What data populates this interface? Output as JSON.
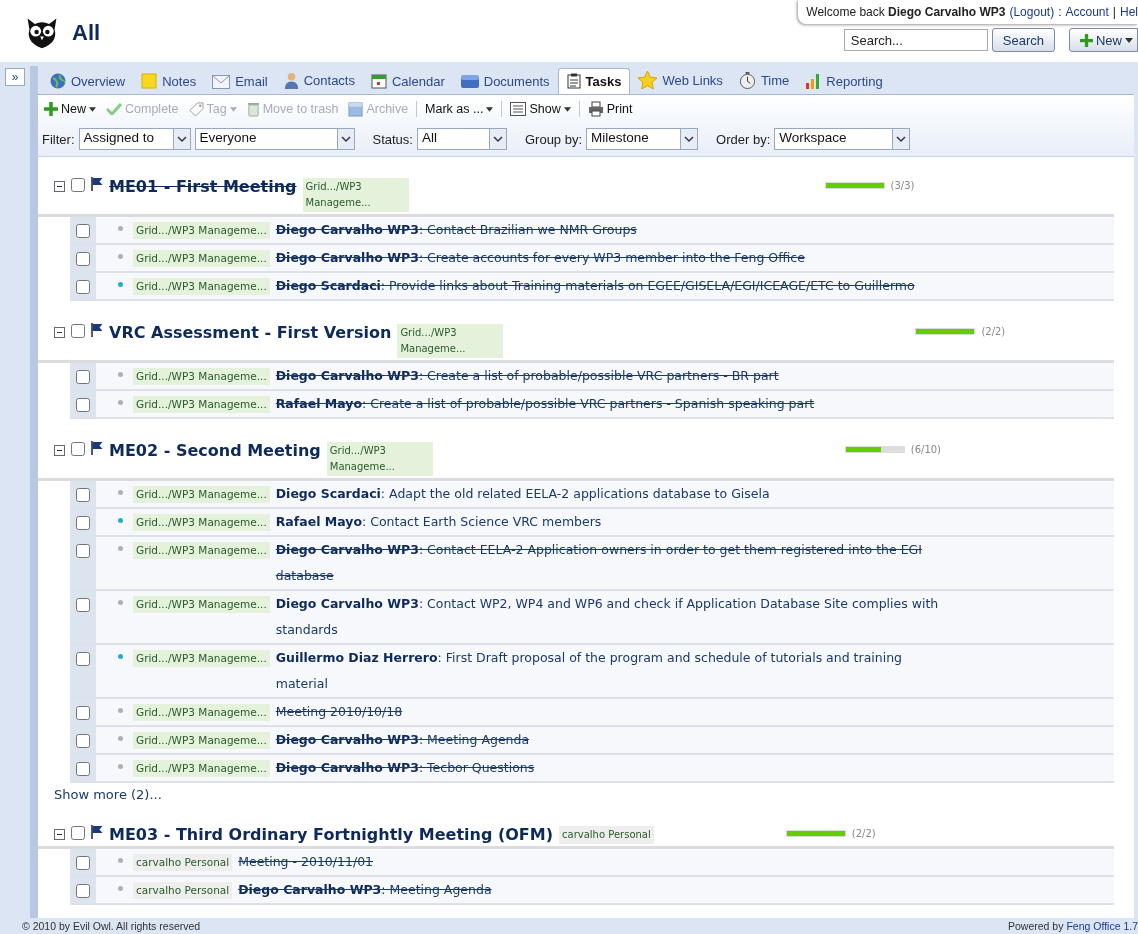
{
  "header": {
    "title": "All",
    "welcome": "Welcome back **Diego Carvalho WP3**",
    "logout": "(Logout)",
    "sep1": ":",
    "account": "Account",
    "sep2": "|",
    "help": "Hel",
    "search_placeholder": "Search...",
    "search_button": "Search",
    "new_button": "New"
  },
  "sidebar": {
    "toggle": "»"
  },
  "tabs": [
    {
      "label": "Overview",
      "selected": false
    },
    {
      "label": "Notes",
      "selected": false
    },
    {
      "label": "Email",
      "selected": false
    },
    {
      "label": "Contacts",
      "selected": false
    },
    {
      "label": "Calendar",
      "selected": false
    },
    {
      "label": "Documents",
      "selected": false
    },
    {
      "label": "Tasks",
      "selected": true
    },
    {
      "label": "Web Links",
      "selected": false
    },
    {
      "label": "Time",
      "selected": false
    },
    {
      "label": "Reporting",
      "selected": false
    }
  ],
  "toolbar": [
    {
      "label": "New",
      "dropdown": true,
      "disabled": false
    },
    {
      "label": "Complete",
      "dropdown": false,
      "disabled": true
    },
    {
      "label": "Tag",
      "dropdown": true,
      "disabled": true
    },
    {
      "label": "Move to trash",
      "dropdown": false,
      "disabled": true
    },
    {
      "label": "Archive",
      "dropdown": false,
      "disabled": true
    },
    {
      "label": "Mark as ...",
      "dropdown": true,
      "disabled": false
    },
    {
      "label": "Show",
      "dropdown": true,
      "disabled": false
    },
    {
      "label": "Print",
      "dropdown": false,
      "disabled": false
    }
  ],
  "filters": [
    {
      "label": "Filter:",
      "selects": [
        "Assigned to",
        "Everyone"
      ]
    },
    {
      "label": "Status:",
      "selects": [
        "All"
      ]
    },
    {
      "label": "Group by:",
      "selects": [
        "Milestone"
      ]
    },
    {
      "label": "Order by:",
      "selects": [
        "Workspace"
      ]
    }
  ],
  "milestones": [
    {
      "title": "ME01 - First Meeting",
      "done": true,
      "checked": false,
      "tag": {
        "label": "Grid.../WP3 Manageme...",
        "color": "#e4f2dc"
      },
      "level": 1,
      "reading": "(3/3)",
      "tasks": [
        {
          "workspace": {
            "label": "Grid.../WP3 Manageme...",
            "color": "#e4f2dc"
          },
          "checked": false,
          "high_priority": false,
          "done": true,
          "text": "**Diego Carvalho WP3**: Contact Brazilian we NMR Groups"
        },
        {
          "workspace": {
            "label": "Grid.../WP3 Manageme...",
            "color": "#e4f2dc"
          },
          "checked": false,
          "high_priority": false,
          "done": true,
          "text": "**Diego Carvalho WP3**: Create accounts for every WP3 member into the Feng Office"
        },
        {
          "workspace": {
            "label": "Grid.../WP3 Manageme...",
            "color": "#e4f2dc"
          },
          "checked": false,
          "high_priority": true,
          "done": true,
          "text": "**Diego Scardaci**: Provide links about Training materials on EGEE/GISELA/EGI/ICEAGE/ETC to Guillermo"
        }
      ]
    },
    {
      "title": "VRC Assessment - First Version",
      "done": false,
      "checked": false,
      "tag": {
        "label": "Grid.../WP3 Manageme...",
        "color": "#e4f2dc"
      },
      "level": 1,
      "reading": "(2/2)",
      "tasks": [
        {
          "workspace": {
            "label": "Grid.../WP3 Manageme...",
            "color": "#e4f2dc"
          },
          "checked": false,
          "high_priority": false,
          "done": true,
          "text": "**Diego Carvalho WP3**: Create a list of probable/possible VRC partners - BR part"
        },
        {
          "workspace": {
            "label": "Grid.../WP3 Manageme...",
            "color": "#e4f2dc"
          },
          "checked": false,
          "high_priority": false,
          "done": true,
          "text": "**Rafael Mayo**: Create a list of probable/possible VRC partners - Spanish speaking part"
        }
      ]
    },
    {
      "title": "ME02 - Second Meeting",
      "done": false,
      "checked": false,
      "tag": {
        "label": "Grid.../WP3 Manageme...",
        "color": "#e4f2dc"
      },
      "level": 0.6,
      "reading": "(6/10)",
      "show_more": "Show more (2)...",
      "tasks": [
        {
          "workspace": {
            "label": "Grid.../WP3 Manageme...",
            "color": "#e4f2dc"
          },
          "checked": false,
          "high_priority": false,
          "done": false,
          "text": "**Diego Scardaci**: Adapt the old related EELA-2 applications database to Gisela"
        },
        {
          "workspace": {
            "label": "Grid.../WP3 Manageme...",
            "color": "#e4f2dc"
          },
          "checked": false,
          "high_priority": true,
          "done": false,
          "text": "**Rafael Mayo**: Contact Earth Science VRC members"
        },
        {
          "workspace": {
            "label": "Grid.../WP3 Manageme...",
            "color": "#e4f2dc"
          },
          "checked": false,
          "high_priority": false,
          "done": true,
          "text": "**Diego Carvalho WP3**: Contact EELA-2 Application owners in order to get them registered into the EGI database"
        },
        {
          "workspace": {
            "label": "Grid.../WP3 Manageme...",
            "color": "#e4f2dc"
          },
          "checked": false,
          "high_priority": false,
          "done": false,
          "text": "**Diego Carvalho WP3**: Contact WP2, WP4 and WP6 and check if Application Database Site complies with standards"
        },
        {
          "workspace": {
            "label": "Grid.../WP3 Manageme...",
            "color": "#e4f2dc"
          },
          "checked": false,
          "high_priority": true,
          "done": false,
          "text": "**Guillermo Diaz Herrero**: First Draft proposal of the program and schedule of tutorials and training material"
        },
        {
          "workspace": {
            "label": "Grid.../WP3 Manageme...",
            "color": "#e4f2dc"
          },
          "checked": false,
          "high_priority": false,
          "done": true,
          "text": "Meeting 2010/10/18"
        },
        {
          "workspace": {
            "label": "Grid.../WP3 Manageme...",
            "color": "#e4f2dc"
          },
          "checked": false,
          "high_priority": false,
          "done": true,
          "text": "**Diego Carvalho WP3**: Meeting Agenda"
        },
        {
          "workspace": {
            "label": "Grid.../WP3 Manageme...",
            "color": "#e4f2dc"
          },
          "checked": false,
          "high_priority": false,
          "done": true,
          "text": "**Diego Carvalho WP3**: Tecbor Questions"
        }
      ]
    },
    {
      "title": "ME03 - Third Ordinary Fortnightly Meeting (OFM)",
      "done": false,
      "checked": false,
      "tag": {
        "label": "carvalho Personal",
        "color": "#eeeeee"
      },
      "level": 1,
      "reading": "(2/2)",
      "tasks": [
        {
          "workspace": {
            "label": "carvalho Personal",
            "color": "#eeeeee"
          },
          "checked": false,
          "high_priority": false,
          "done": true,
          "text": "Meeting - 2010/11/01"
        },
        {
          "workspace": {
            "label": "carvalho Personal",
            "color": "#eeeeee"
          },
          "checked": false,
          "high_priority": false,
          "done": true,
          "text": "**Diego Carvalho WP3**: Meeting Agenda"
        }
      ]
    }
  ],
  "footer": {
    "copyright": "© 2010 by Evil Owl. All rights reserved",
    "powered": "Powered by",
    "product": "Feng Office 1.7"
  }
}
